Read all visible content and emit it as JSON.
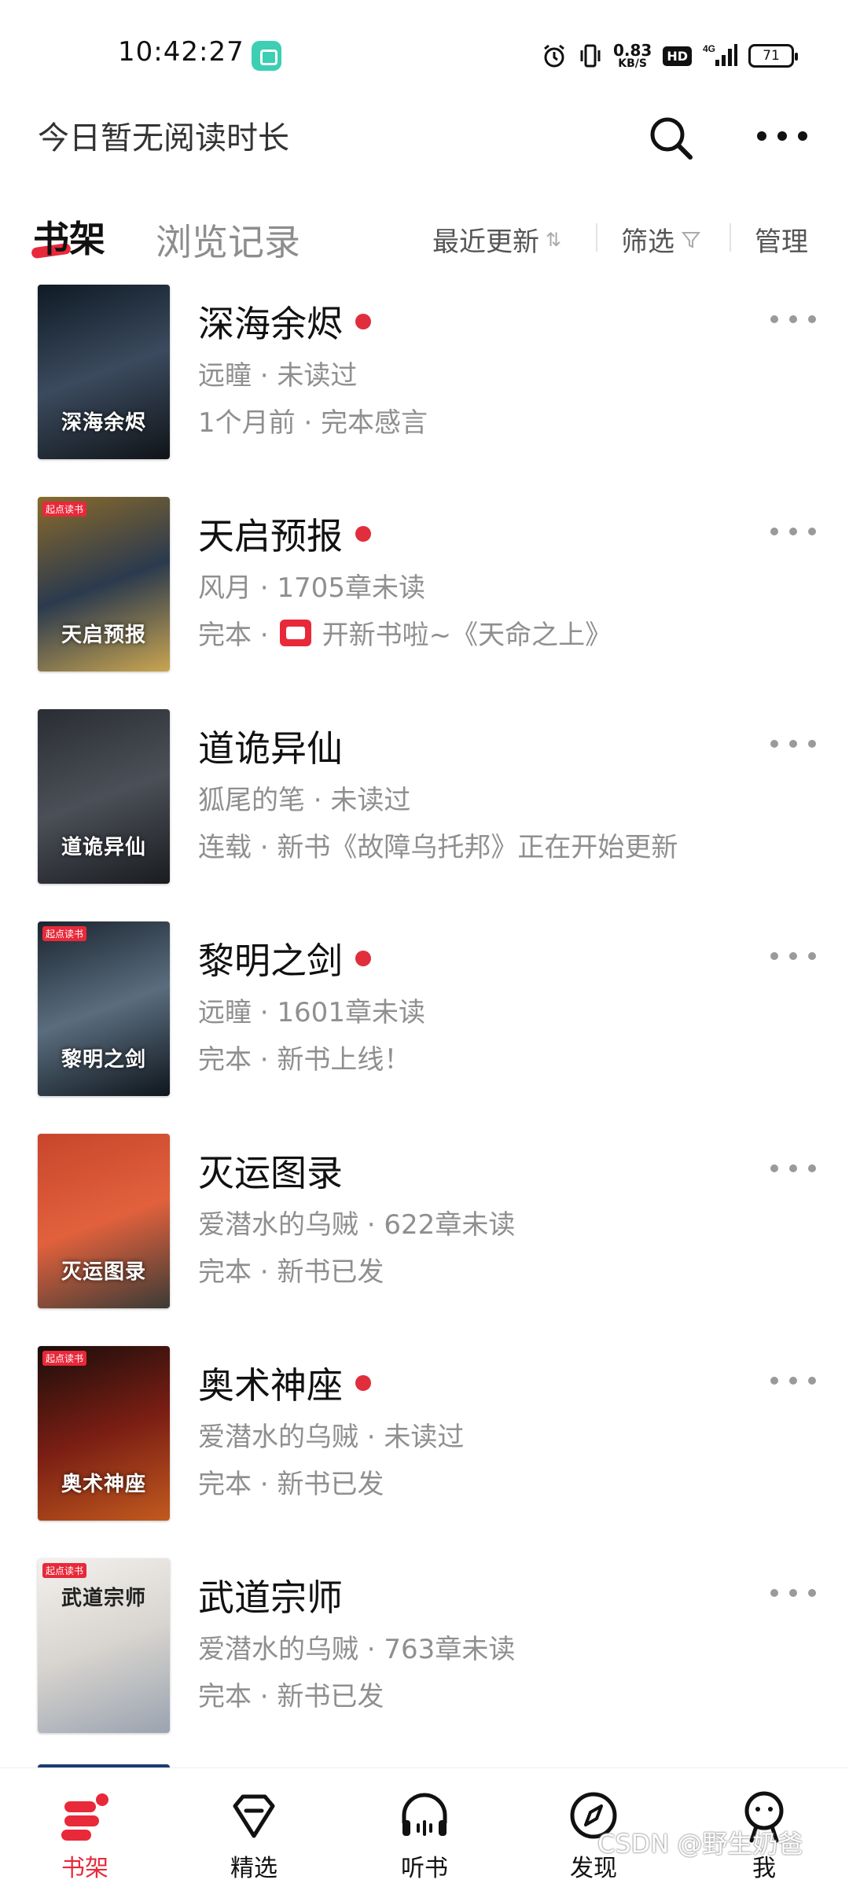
{
  "status_bar": {
    "time": "10:42:27",
    "net_speed_value": "0.83",
    "net_speed_unit": "KB/S",
    "hd_label": "HD",
    "network_label": "4G",
    "battery": "71"
  },
  "header": {
    "reading_time": "今日暂无阅读时长"
  },
  "tabs": {
    "shelf": "书架",
    "history": "浏览记录",
    "sort": "最近更新",
    "filter": "筛选",
    "manage": "管理"
  },
  "books": [
    {
      "title": "深海余烬",
      "unread_dot": true,
      "line1": "远瞳 · 未读过",
      "line2": "1个月前 · 完本感言",
      "cover_text": "深海余烬",
      "cover_colors": [
        "#0f1a24",
        "#3b4a5e",
        "#101418"
      ]
    },
    {
      "title": "天启预报",
      "unread_dot": true,
      "line1": "风月 · 1705章未读",
      "line2_prefix": "完本 · ",
      "line2": "开新书啦~《天命之上》",
      "cover_text": "天启预报",
      "cover_colors": [
        "#8a6a2a",
        "#2b3a4e",
        "#c9a550"
      ]
    },
    {
      "title": "道诡异仙",
      "unread_dot": false,
      "line1": "狐尾的笔 · 未读过",
      "line2": "连载 · 新书《故障乌托邦》正在开始更新",
      "cover_text": "道诡异仙",
      "cover_colors": [
        "#2a2d33",
        "#4b4f57",
        "#1a1c20"
      ]
    },
    {
      "title": "黎明之剑",
      "unread_dot": true,
      "line1": "远瞳 · 1601章未读",
      "line2": "完本 · 新书上线！",
      "cover_text": "黎明之剑",
      "cover_colors": [
        "#1b2530",
        "#5a6d7e",
        "#0f161d"
      ]
    },
    {
      "title": "灭运图录",
      "unread_dot": false,
      "line1": "爱潜水的乌贼 · 622章未读",
      "line2": "完本 · 新书已发",
      "cover_text": "灭运图录",
      "cover_colors": [
        "#c8452c",
        "#e2613c",
        "#3b3b36"
      ]
    },
    {
      "title": "奥术神座",
      "unread_dot": true,
      "line1": "爱潜水的乌贼 · 未读过",
      "line2": "完本 · 新书已发",
      "cover_text": "奥术神座",
      "cover_colors": [
        "#1a0d0a",
        "#7a1e14",
        "#c25a1e"
      ]
    },
    {
      "title": "武道宗师",
      "unread_dot": false,
      "line1": "爱潜水的乌贼 · 763章未读",
      "line2": "完本 · 新书已发",
      "cover_text": "武道宗师",
      "cover_colors": [
        "#f3f1ee",
        "#d8d4cf",
        "#9aa3b0"
      ]
    }
  ],
  "cover_tag": "起点读书",
  "nav": [
    {
      "label": "书架",
      "icon": "bookshelf-icon",
      "active": true
    },
    {
      "label": "精选",
      "icon": "gem-icon",
      "active": false
    },
    {
      "label": "听书",
      "icon": "headphones-icon",
      "active": false
    },
    {
      "label": "发现",
      "icon": "compass-icon",
      "active": false
    },
    {
      "label": "我",
      "icon": "profile-icon",
      "active": false
    }
  ],
  "watermark": "CSDN @野生奶爸",
  "colors": {
    "accent": "#e8293a",
    "muted_text": "#8f8f8f"
  }
}
